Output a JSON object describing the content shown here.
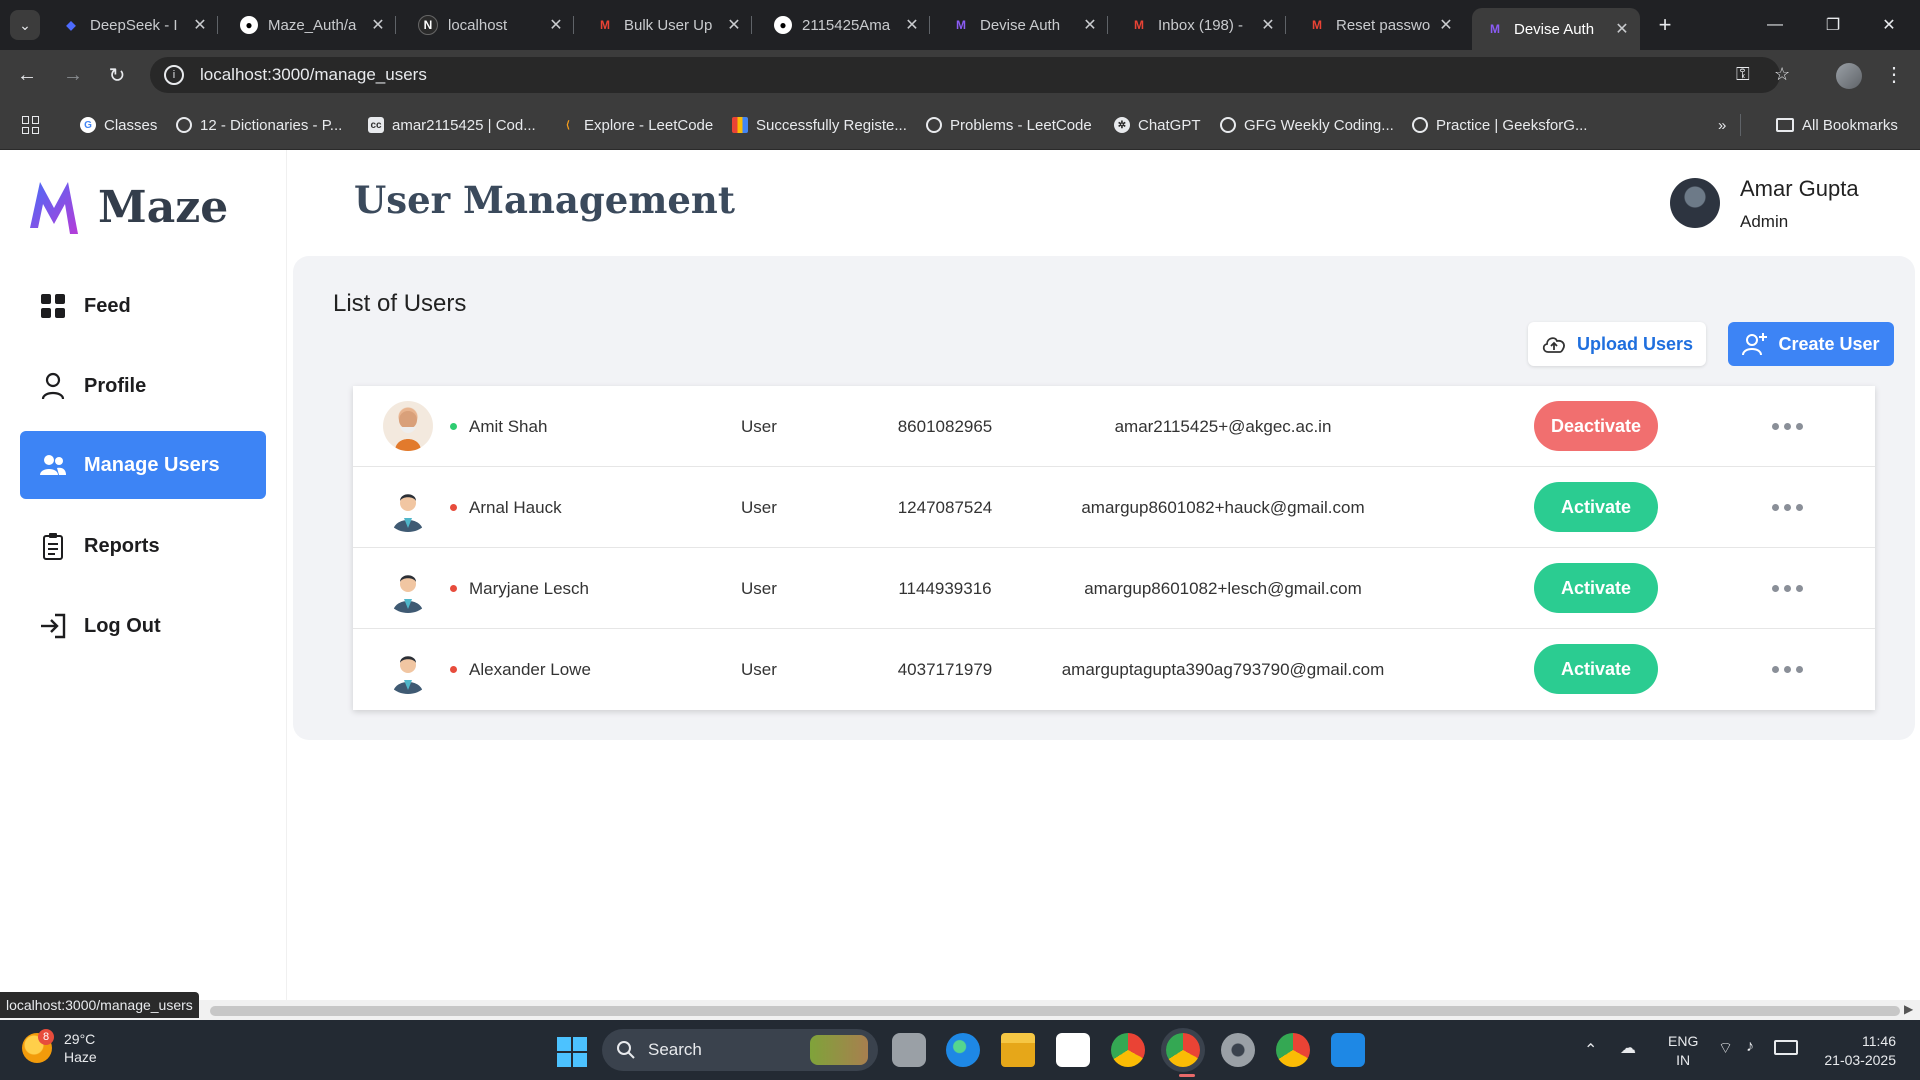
{
  "browser": {
    "tabs": [
      {
        "label": "DeepSeek - I",
        "icon": "deepseek-icon"
      },
      {
        "label": "Maze_Auth/a",
        "icon": "github-icon"
      },
      {
        "label": "localhost",
        "icon": "notion-icon"
      },
      {
        "label": "Bulk User Up",
        "icon": "gmail-icon"
      },
      {
        "label": "2115425Ama",
        "icon": "github-icon"
      },
      {
        "label": "Devise Auth",
        "icon": "maze-icon"
      },
      {
        "label": "Inbox (198) -",
        "icon": "gmail-icon"
      },
      {
        "label": "Reset passwo",
        "icon": "gmail-icon"
      },
      {
        "label": "Devise Auth",
        "icon": "maze-icon",
        "active": true
      }
    ],
    "url": "localhost:3000/manage_users",
    "bookmarks": [
      {
        "label": "Classes"
      },
      {
        "label": "12 - Dictionaries - P..."
      },
      {
        "label": "amar2115425 | Cod..."
      },
      {
        "label": "Explore - LeetCode"
      },
      {
        "label": "Successfully Registe..."
      },
      {
        "label": "Problems - LeetCode"
      },
      {
        "label": "ChatGPT"
      },
      {
        "label": "GFG Weekly Coding..."
      },
      {
        "label": "Practice | GeeksforG..."
      }
    ],
    "all_bookmarks": "All Bookmarks",
    "status_url": "localhost:3000/manage_users"
  },
  "app": {
    "logo_text": "Maze",
    "nav": [
      {
        "label": "Feed",
        "icon": "grid-icon"
      },
      {
        "label": "Profile",
        "icon": "person-icon"
      },
      {
        "label": "Manage Users",
        "icon": "users-icon",
        "active": true
      },
      {
        "label": "Reports",
        "icon": "clipboard-icon"
      },
      {
        "label": "Log Out",
        "icon": "logout-icon"
      }
    ],
    "page_title": "User Management",
    "user": {
      "name": "Amar Gupta",
      "role": "Admin"
    },
    "list_title": "List of Users",
    "upload_label": "Upload Users",
    "create_label": "Create User",
    "users": [
      {
        "name": "Amit Shah",
        "role": "User",
        "phone": "8601082965",
        "email": "amar2115425+@akgec.ac.in",
        "status_color": "#2ecc71",
        "action": "Deactivate",
        "action_color": "#f16f6f"
      },
      {
        "name": "Arnal Hauck",
        "role": "User",
        "phone": "1247087524",
        "email": "amargup8601082+hauck@gmail.com",
        "status_color": "#e74c3c",
        "action": "Activate",
        "action_color": "#2bcc91"
      },
      {
        "name": "Maryjane Lesch",
        "role": "User",
        "phone": "1144939316",
        "email": "amargup8601082+lesch@gmail.com",
        "status_color": "#e74c3c",
        "action": "Activate",
        "action_color": "#2bcc91"
      },
      {
        "name": "Alexander Lowe",
        "role": "User",
        "phone": "4037171979",
        "email": "amarguptagupta390ag793790@gmail.com",
        "status_color": "#e74c3c",
        "action": "Activate",
        "action_color": "#2bcc91"
      }
    ]
  },
  "taskbar": {
    "weather_temp": "29°C",
    "weather_desc": "Haze",
    "weather_badge": "8",
    "search_label": "Search",
    "lang_1": "ENG",
    "lang_2": "IN",
    "time": "11:46",
    "date": "21-03-2025"
  }
}
